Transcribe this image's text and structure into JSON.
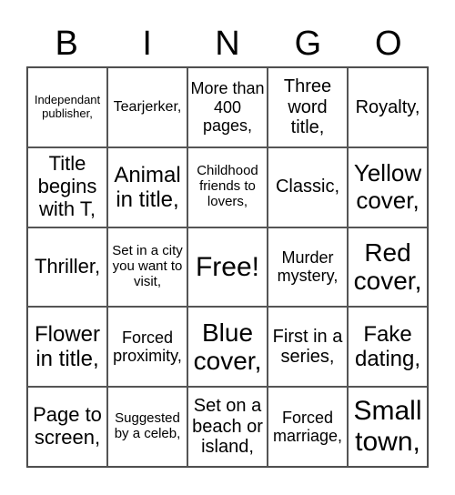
{
  "header": [
    "B",
    "I",
    "N",
    "G",
    "O"
  ],
  "cells": [
    "Independant publisher,",
    "Tearjerker,",
    "More than 400 pages,",
    "Three word title,",
    "Royalty,",
    "Title begins with T,",
    "Animal in title,",
    "Childhood friends to lovers,",
    "Classic,",
    "Yellow cover,",
    "Thriller,",
    "Set in a city you want to visit,",
    "Free!",
    "Murder mystery,",
    "Red cover,",
    "Flower in title,",
    "Forced proximity,",
    "Blue cover,",
    "First in a series,",
    "Fake dating,",
    "Page to screen,",
    "Suggested by a celeb,",
    "Set on a beach or island,",
    "Forced marriage,",
    "Small town,"
  ]
}
